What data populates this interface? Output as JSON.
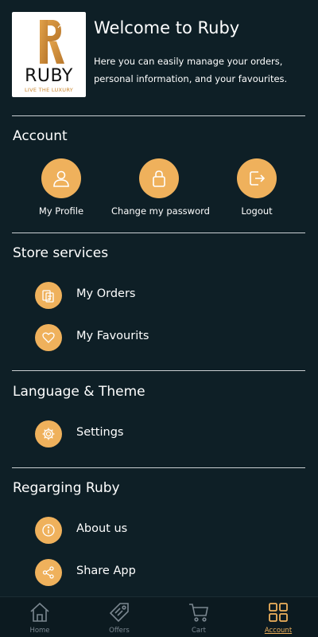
{
  "header": {
    "logo_word": "RUBY",
    "logo_tagline": "LIVE THE LUXURY",
    "title": "Welcome to Ruby",
    "subtitle": "Here you can easily manage your orders, personal information, and your favourites."
  },
  "account": {
    "title": "Account",
    "items": [
      {
        "label": "My Profile",
        "icon": "user-icon"
      },
      {
        "label": "Change my password",
        "icon": "lock-icon"
      },
      {
        "label": "Logout",
        "icon": "logout-icon"
      }
    ]
  },
  "store_services": {
    "title": "Store services",
    "items": [
      {
        "label": "My Orders",
        "icon": "orders-icon"
      },
      {
        "label": "My Favourits",
        "icon": "heart-icon"
      }
    ]
  },
  "language_theme": {
    "title": "Language & Theme",
    "items": [
      {
        "label": "Settings",
        "icon": "gear-icon"
      }
    ]
  },
  "regarding": {
    "title": "Regarging Ruby",
    "items": [
      {
        "label": "About us",
        "icon": "info-icon"
      },
      {
        "label": "Share App",
        "icon": "share-icon"
      }
    ]
  },
  "bottom_nav": {
    "items": [
      {
        "label": "Home",
        "icon": "home-icon"
      },
      {
        "label": "Offers",
        "icon": "tag-icon"
      },
      {
        "label": "Cart",
        "icon": "cart-icon"
      },
      {
        "label": "Account",
        "icon": "grid-icon"
      }
    ],
    "active": "Account"
  },
  "colors": {
    "background": "#0e1f26",
    "accent": "#efb15c",
    "text": "#ffffff",
    "nav_inactive": "#7b8790"
  }
}
